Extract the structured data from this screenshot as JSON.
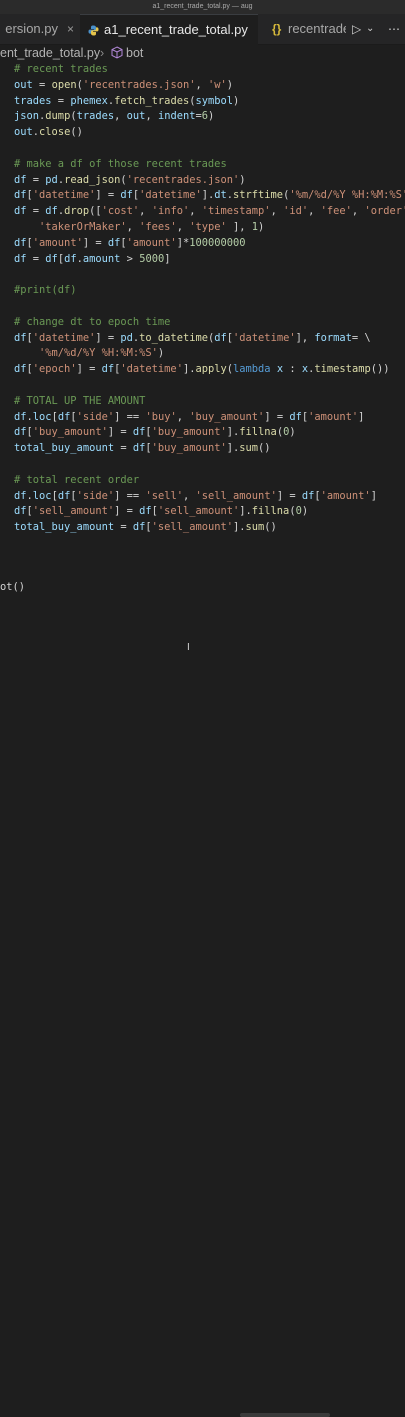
{
  "window": {
    "title": "a1_recent_trade_total.py — aug"
  },
  "tabs": {
    "left": {
      "label": "ersion.py",
      "close": "×"
    },
    "active": {
      "label": "a1_recent_trade_total.py",
      "close": "×"
    },
    "right": {
      "label": "recentrade",
      "icon_text": "{}"
    }
  },
  "toolbar": {
    "run": "▷",
    "dropdown": "⌄",
    "more": "⋯"
  },
  "breadcrumb": {
    "file": "ent_trade_total.py",
    "separator": "›",
    "symbol": "bot"
  },
  "editor": {
    "tail_text": "ot()"
  }
}
